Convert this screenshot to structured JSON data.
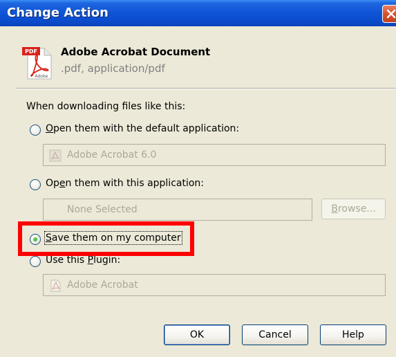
{
  "window": {
    "title": "Change Action"
  },
  "header": {
    "doc_title": "Adobe Acrobat Document",
    "doc_subtitle": ".pdf, application/pdf",
    "icon_label": "PDF"
  },
  "section": {
    "prompt": "When downloading files like this:"
  },
  "options": {
    "default_app": {
      "accel": "O",
      "rest": "pen them with the default application:",
      "field_value": "Adobe Acrobat 6.0",
      "selected": false
    },
    "this_app": {
      "pre": "Op",
      "accel": "e",
      "rest": "n them with this application:",
      "field_value": "None Selected",
      "browse_pre": "",
      "browse_accel": "B",
      "browse_rest": "rowse...",
      "selected": false
    },
    "save": {
      "accel": "S",
      "rest": "ave them on my computer",
      "selected": true
    },
    "plugin": {
      "pre": "Use this ",
      "accel": "P",
      "rest": "lugin:",
      "field_value": "Adobe Acrobat",
      "selected": false
    }
  },
  "buttons": {
    "ok": "OK",
    "cancel": "Cancel",
    "help": "Help"
  },
  "colors": {
    "highlight": "#ff0000",
    "titlebar": "#0f53d6"
  }
}
